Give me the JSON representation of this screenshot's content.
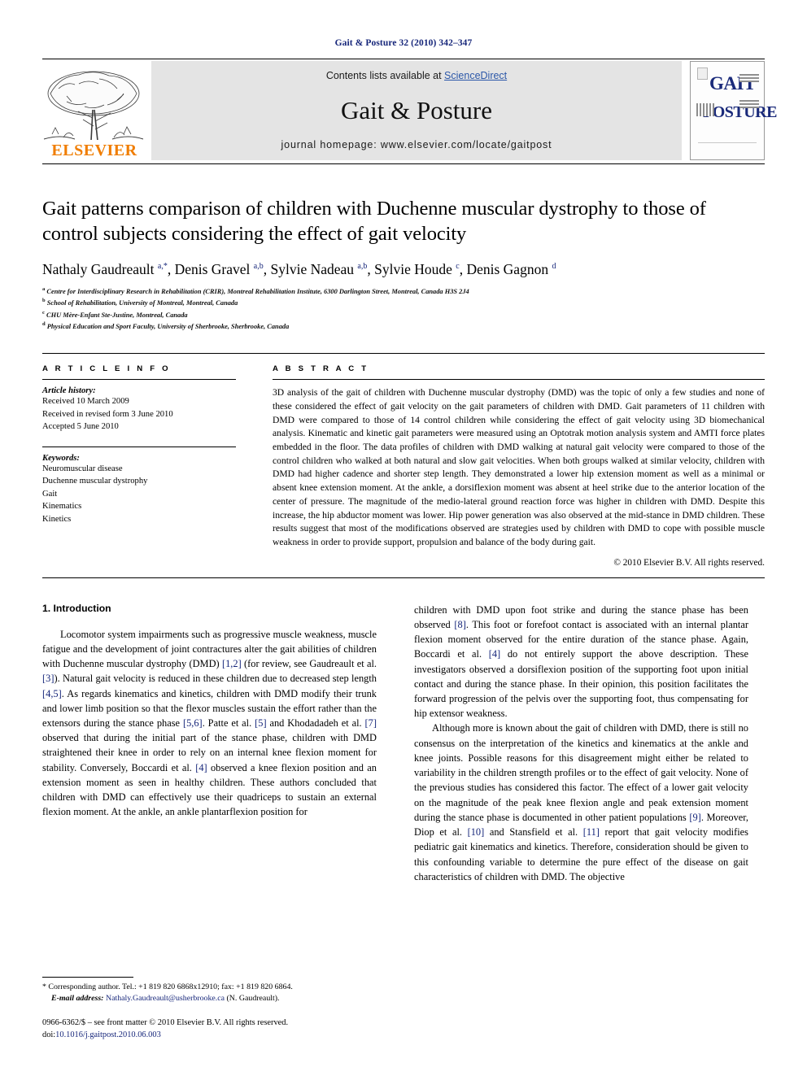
{
  "running_head": "Gait & Posture 32 (2010) 342–347",
  "masthead": {
    "contents_prefix": "Contents lists available at ",
    "science_direct": "ScienceDirect",
    "journal_title": "Gait & Posture",
    "homepage": "journal homepage: www.elsevier.com/locate/gaitpost",
    "publisher_logo_text": "ELSEVIER",
    "cover": {
      "line1": "GAIT",
      "line2": "POSTURE"
    }
  },
  "article": {
    "title": "Gait patterns comparison of children with Duchenne muscular dystrophy to those of control subjects considering the effect of gait velocity",
    "authors_html": "Nathaly Gaudreault <sup>a,*</sup>, Denis Gravel <sup>a,b</sup>, Sylvie Nadeau <sup>a,b</sup>, Sylvie Houde <sup>c</sup>, Denis Gagnon <sup>d</sup>",
    "affiliations": [
      {
        "marker": "a",
        "text": "Centre for Interdisciplinary Research in Rehabilitation (CRIR), Montreal Rehabilitation Institute, 6300 Darlington Street, Montreal, Canada H3S 2J4"
      },
      {
        "marker": "b",
        "text": "School of Rehabilitation, University of Montreal, Montreal, Canada"
      },
      {
        "marker": "c",
        "text": "CHU Mère-Enfant Ste-Justine, Montreal, Canada"
      },
      {
        "marker": "d",
        "text": "Physical Education and Sport Faculty, University of Sherbrooke, Sherbrooke, Canada"
      }
    ]
  },
  "article_info": {
    "label": "A R T I C L E   I N F O",
    "history_heading": "Article history:",
    "history": [
      "Received 10 March 2009",
      "Received in revised form 3 June 2010",
      "Accepted 5 June 2010"
    ],
    "keywords_heading": "Keywords:",
    "keywords": [
      "Neuromuscular disease",
      "Duchenne muscular dystrophy",
      "Gait",
      "Kinematics",
      "Kinetics"
    ]
  },
  "abstract": {
    "label": "A B S T R A C T",
    "text": "3D analysis of the gait of children with Duchenne muscular dystrophy (DMD) was the topic of only a few studies and none of these considered the effect of gait velocity on the gait parameters of children with DMD. Gait parameters of 11 children with DMD were compared to those of 14 control children while considering the effect of gait velocity using 3D biomechanical analysis. Kinematic and kinetic gait parameters were measured using an Optotrak motion analysis system and AMTI force plates embedded in the floor. The data profiles of children with DMD walking at natural gait velocity were compared to those of the control children who walked at both natural and slow gait velocities. When both groups walked at similar velocity, children with DMD had higher cadence and shorter step length. They demonstrated a lower hip extension moment as well as a minimal or absent knee extension moment. At the ankle, a dorsiflexion moment was absent at heel strike due to the anterior location of the center of pressure. The magnitude of the medio-lateral ground reaction force was higher in children with DMD. Despite this increase, the hip abductor moment was lower. Hip power generation was also observed at the mid-stance in DMD children. These results suggest that most of the modifications observed are strategies used by children with DMD to cope with possible muscle weakness in order to provide support, propulsion and balance of the body during gait.",
    "copyright": "© 2010 Elsevier B.V. All rights reserved."
  },
  "body": {
    "section_heading": "1. Introduction",
    "left_paragraph_1_part1": "Locomotor system impairments such as progressive muscle weakness, muscle fatigue and the development of joint contractures alter the gait abilities of children with Duchenne muscular dystrophy (DMD) ",
    "ref_1_2": "[1,2]",
    "left_paragraph_1_part2": " (for review, see Gaudreault et al. ",
    "ref_3": "[3]",
    "left_paragraph_1_part3": "). Natural gait velocity is reduced in these children due to decreased step length ",
    "ref_4_5": "[4,5]",
    "left_paragraph_1_part4": ". As regards kinematics and kinetics, children with DMD modify their trunk and lower limb position so that the flexor muscles sustain the effort rather than the extensors during the stance phase ",
    "ref_5_6": "[5,6]",
    "left_paragraph_1_part5": ". Patte et al. ",
    "ref_5": "[5]",
    "left_paragraph_1_part6": " and Khodadadeh et al. ",
    "ref_7": "[7]",
    "left_paragraph_1_part7": " observed that during the initial part of the stance phase, children with DMD straightened their knee in order to rely on an internal knee flexion moment for stability. Conversely, Boccardi et al. ",
    "ref_4": "[4]",
    "left_paragraph_1_part8": " observed a knee flexion position and an extension moment as seen in healthy children. These authors concluded that children with DMD can effectively use their quadriceps to sustain an external flexion moment. At the ankle, an ankle plantarflexion position for",
    "right_paragraph_1_part1": "children with DMD upon foot strike and during the stance phase has been observed ",
    "ref_8": "[8]",
    "right_paragraph_1_part2": ". This foot or forefoot contact is associated with an internal plantar flexion moment observed for the entire duration of the stance phase. Again, Boccardi et al. ",
    "ref_4b": "[4]",
    "right_paragraph_1_part3": " do not entirely support the above description. These investigators observed a dorsiflexion position of the supporting foot upon initial contact and during the stance phase. In their opinion, this position facilitates the forward progression of the pelvis over the supporting foot, thus compensating for hip extensor weakness.",
    "right_paragraph_2_part1": "Although more is known about the gait of children with DMD, there is still no consensus on the interpretation of the kinetics and kinematics at the ankle and knee joints. Possible reasons for this disagreement might either be related to variability in the children strength profiles or to the effect of gait velocity. None of the previous studies has considered this factor. The effect of a lower gait velocity on the magnitude of the peak knee flexion angle and peak extension moment during the stance phase is documented in other patient populations ",
    "ref_9": "[9]",
    "right_paragraph_2_part2": ". Moreover, Diop et al. ",
    "ref_10": "[10]",
    "right_paragraph_2_part3": " and Stansfield et al. ",
    "ref_11": "[11]",
    "right_paragraph_2_part4": " report that gait velocity modifies pediatric gait kinematics and kinetics. Therefore, consideration should be given to this confounding variable to determine the pure effect of the disease on gait characteristics of children with DMD. The objective"
  },
  "footnotes": {
    "corresponding": "* Corresponding author. Tel.: +1 819 820 6868x12910; fax: +1 819 820 6864.",
    "email_label": "E-mail address:",
    "email": "Nathaly.Gaudreault@usherbrooke.ca",
    "email_suffix": "(N. Gaudreault).",
    "imprint": "0966-6362/$ – see front matter © 2010 Elsevier B.V. All rights reserved.",
    "doi_label": "doi:",
    "doi": "10.1016/j.gaitpost.2010.06.003"
  },
  "colors": {
    "link_blue": "#16267a",
    "science_direct_blue": "#2b57a8",
    "elsevier_orange": "#f07d00",
    "masthead_gray": "#e4e4e4"
  }
}
